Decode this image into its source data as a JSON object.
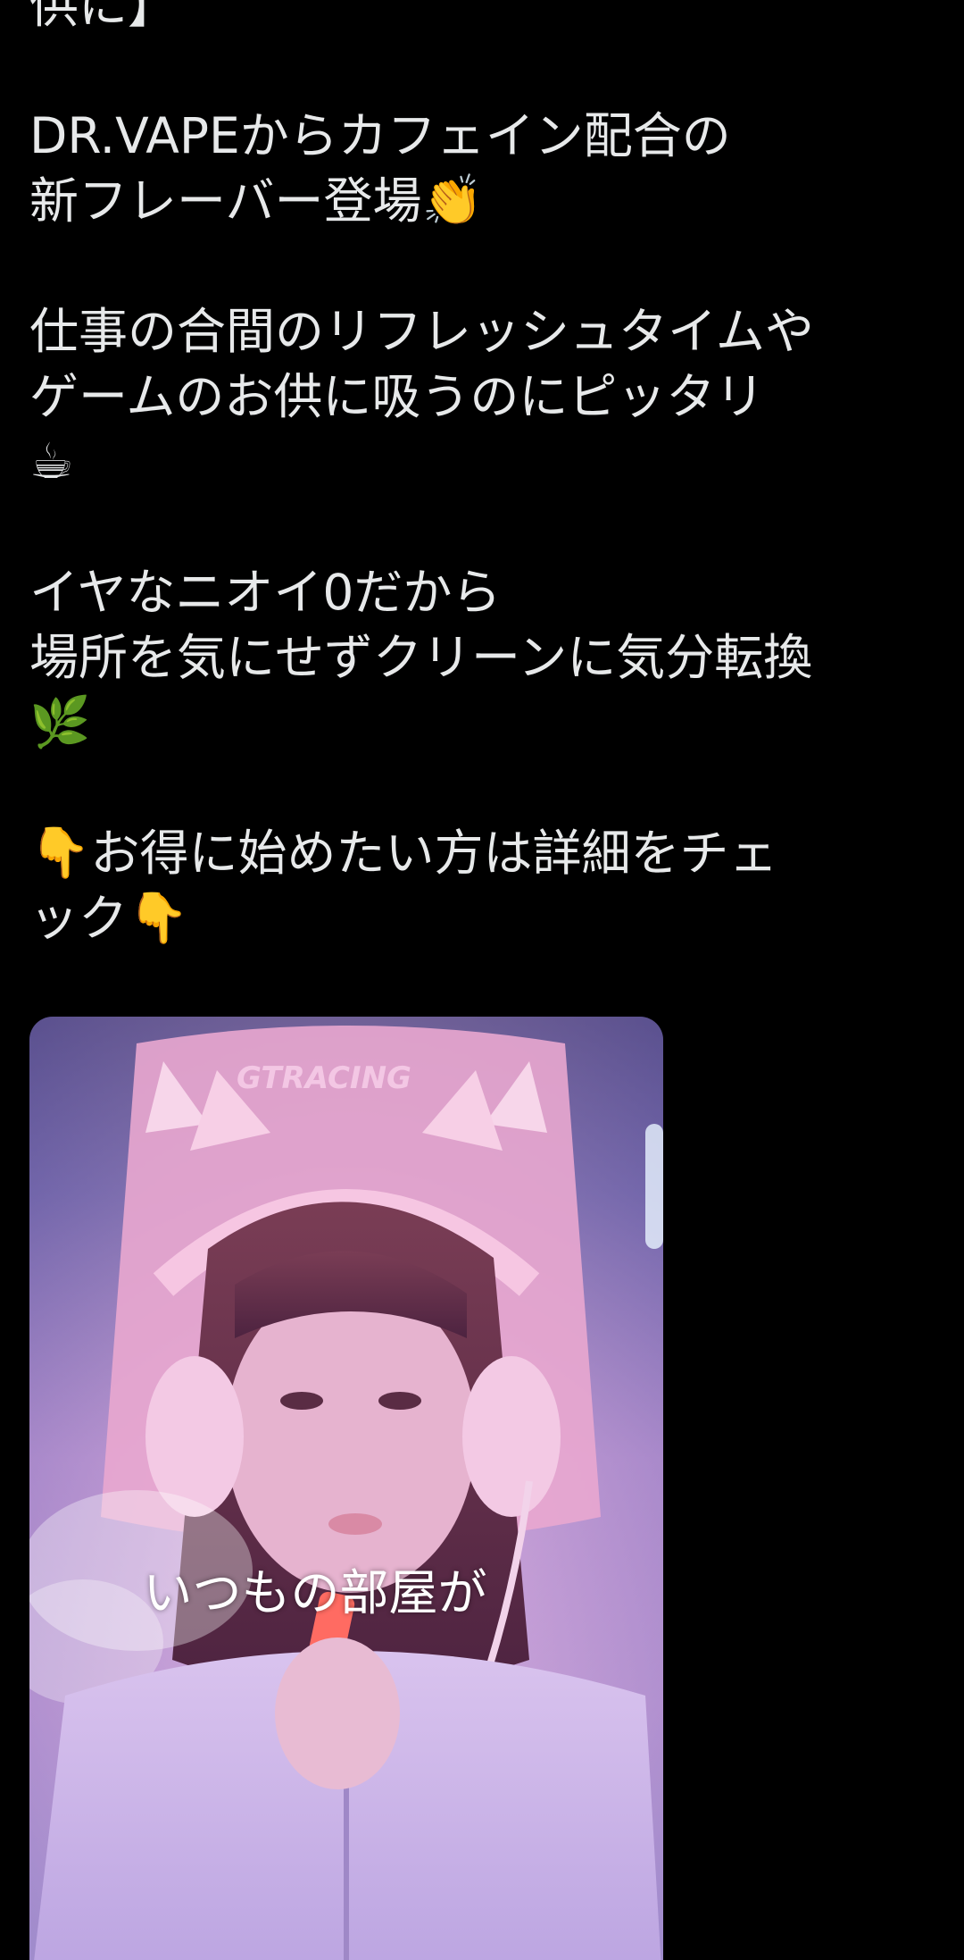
{
  "post": {
    "lines": {
      "l0": "供に】",
      "l1": "DR.VAPEからカフェイン配合の",
      "l2": "新フレーバー登場",
      "l2_emoji": "👏",
      "l3": "仕事の合間のリフレッシュタイムや",
      "l4": "ゲームのお供に吸うのにピッタリ",
      "l5_emoji": "☕",
      "l6": "イヤなニオイ0だから",
      "l7": "場所を気にせずクリーンに気分転換",
      "l8_emoji": "🌿",
      "l9_emoji": "👇",
      "l9": "お得に始めたい方は詳細をチェ",
      "l10": "ック",
      "l10_emoji": "👇"
    }
  },
  "media": {
    "chair_brand": "GTRACING",
    "caption": "いつもの部屋が"
  }
}
